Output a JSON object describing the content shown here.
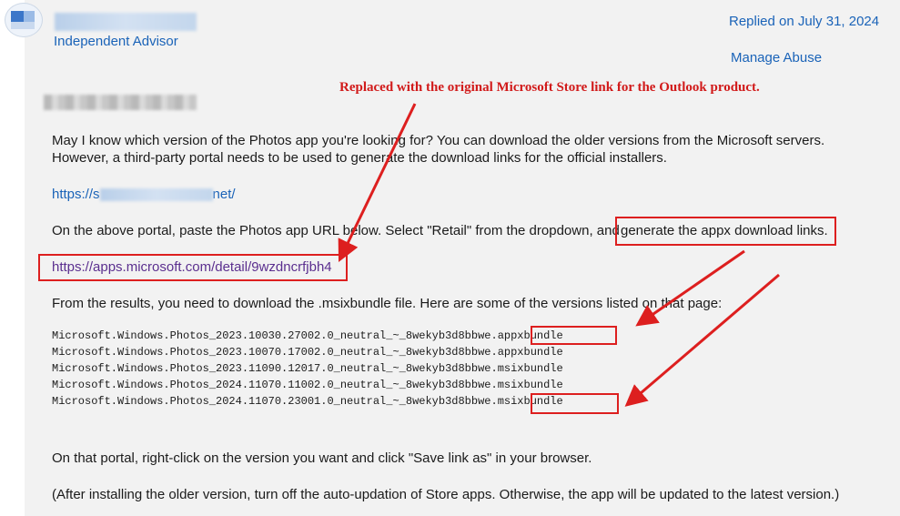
{
  "header": {
    "role": "Independent Advisor",
    "date": "Replied on July 31, 2024",
    "manage_abuse": "Manage Abuse"
  },
  "annotation": {
    "text": "Replaced with the original Microsoft Store link for the Outlook product.",
    "color": "#dd1f1f"
  },
  "body": {
    "p1_line1": "May I know which version of the Photos app you're looking for? You can download the older versions from the Microsoft servers.",
    "p1_line2": "However, a third-party portal needs to be used to generate the download links for the official installers.",
    "portal_link_prefix": "https://s",
    "portal_link_suffix": "net/",
    "p2_start": "On the above portal, paste the Photos app URL below. Select \"Retail\" from the dropdown, and",
    "p2_end": "generate the appx download links.",
    "store_link": "https://apps.microsoft.com/detail/9wzdncrfjbh4",
    "p3": "From the results, you need to download the .msixbundle file. Here are some of the versions listed on that page:",
    "files": [
      {
        "name": "Microsoft.Windows.Photos_2023.10030.27002.0_neutral_~_8wekyb3d8bbwe.",
        "ext": "appxbundle"
      },
      {
        "name": "Microsoft.Windows.Photos_2023.10070.17002.0_neutral_~_8wekyb3d8bbwe.",
        "ext": "appxbundle"
      },
      {
        "name": "Microsoft.Windows.Photos_2023.11090.12017.0_neutral_~_8wekyb3d8bbwe.",
        "ext": "msixbundle"
      },
      {
        "name": "Microsoft.Windows.Photos_2024.11070.11002.0_neutral_~_8wekyb3d8bbwe.",
        "ext": "msixbundle"
      },
      {
        "name": "Microsoft.Windows.Photos_2024.11070.23001.0_neutral_~_8wekyb3d8bbwe.",
        "ext": "msixbundle"
      }
    ],
    "p4": "On that portal, right-click on the version you want and click \"Save link as\" in your browser.",
    "p5": "(After installing the older version, turn off the auto-updation of Store apps. Otherwise, the app will be updated to the latest version.)"
  }
}
